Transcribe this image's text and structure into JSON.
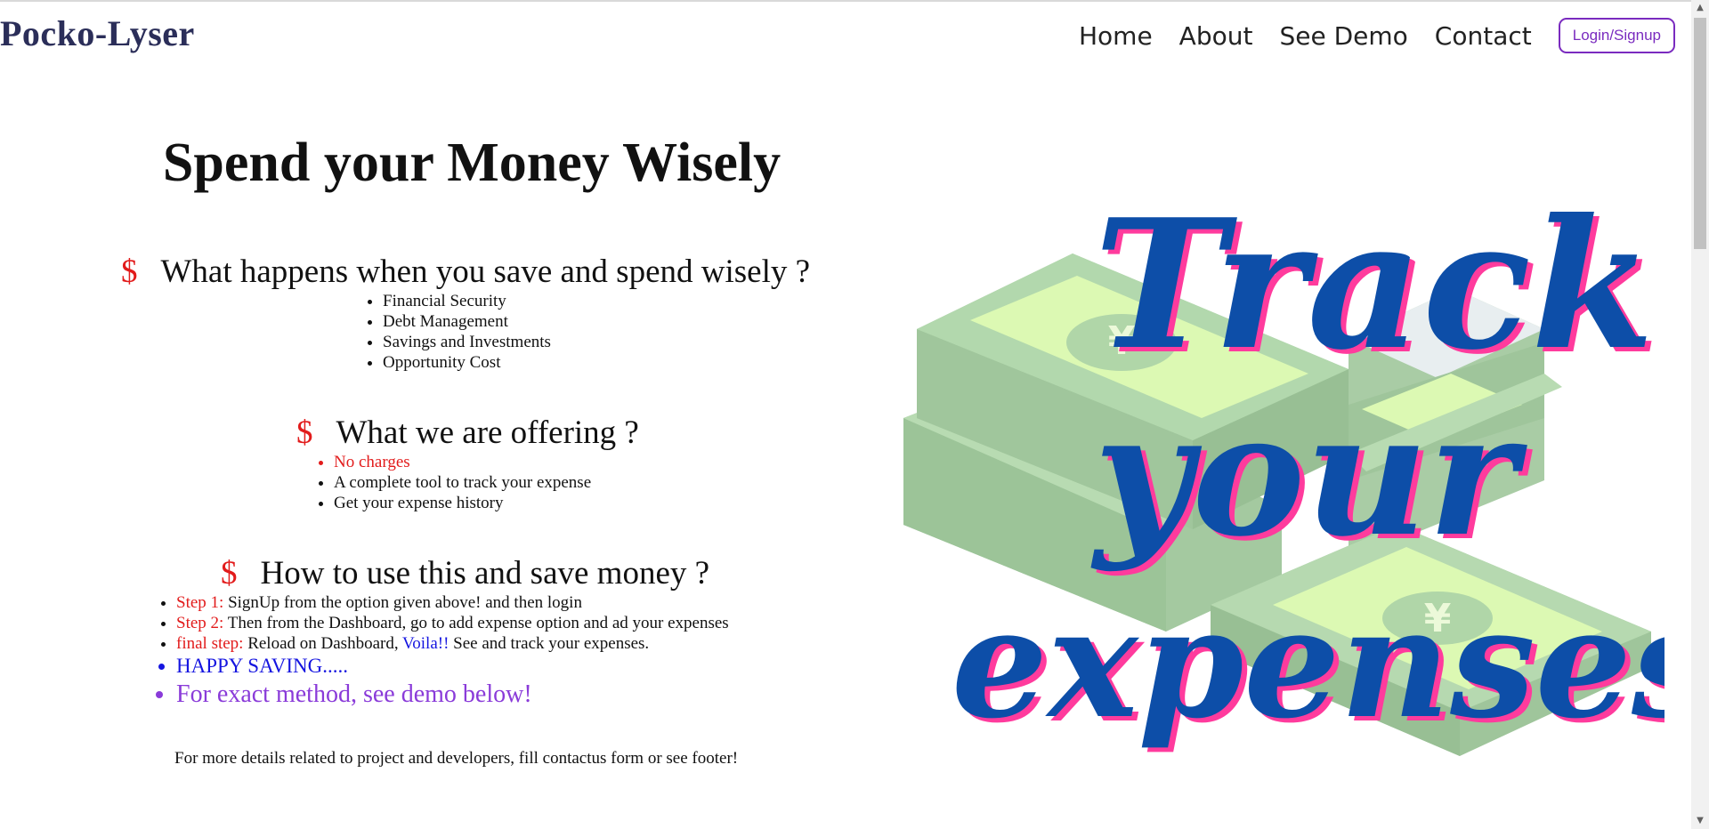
{
  "brand": "Pocko-Lyser",
  "nav": {
    "home": "Home",
    "about": "About",
    "demo": "See Demo",
    "contact": "Contact",
    "login": "Login/Signup"
  },
  "hero": {
    "title": "Spend your Money Wisely"
  },
  "sections": {
    "save": {
      "symbol": "$",
      "heading": "What happens when you save and spend wisely ?",
      "items": [
        "Financial Security",
        "Debt Management",
        "Savings and Investments",
        "Opportunity Cost"
      ]
    },
    "offer": {
      "symbol": "$",
      "heading": "What we are offering ?",
      "items": [
        "No charges",
        "A complete tool to track your expense",
        "Get your expense history"
      ]
    },
    "howto": {
      "symbol": "$",
      "heading": "How to use this and save money ?",
      "steps": [
        {
          "label": "Step 1:",
          "text": " SignUp from the option given above! and then login"
        },
        {
          "label": "Step 2:",
          "text": " Then from the Dashboard, go to add expense option and ad your expenses"
        },
        {
          "label": "final step:",
          "text": " Reload on Dashboard, ",
          "highlight": "Voila!!",
          "tail": " See and track your expenses."
        }
      ],
      "happy": "HAPPY SAVING.....",
      "demo_hint": "For exact method, see demo below!"
    }
  },
  "footer_note": "For more details related to project and developers, fill contactus form or see footer!",
  "illustration": {
    "lines": [
      "Track",
      "your",
      "expenses"
    ],
    "currency_symbol": "¥",
    "icon": "money-stack-illustration"
  },
  "colors": {
    "brand": "#2b2e59",
    "accent_red": "#e21b1b",
    "accent_blue": "#1515e0",
    "accent_purple": "#8a3bd9",
    "login_border": "#7a2bbf",
    "bill_light": "#a9d5a8",
    "bill_face": "#dcf9b3",
    "script_blue": "#0d4ea8",
    "script_pink": "#ff3b9d"
  }
}
